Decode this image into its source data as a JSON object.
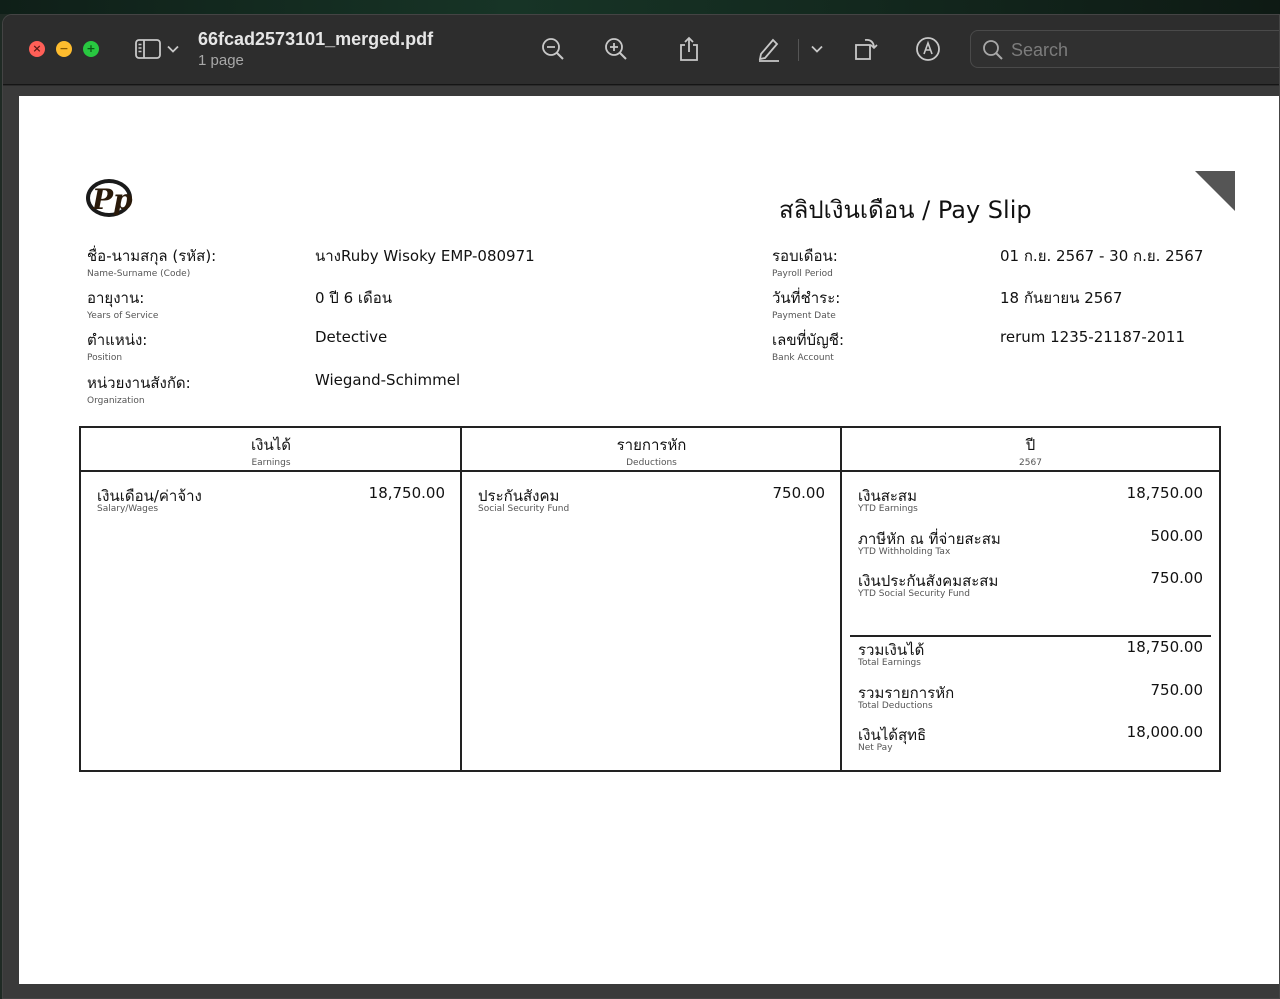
{
  "window": {
    "filename": "66fcad2573101_merged.pdf",
    "page_count": "1 page",
    "search_placeholder": "Search"
  },
  "icons": [
    "close-icon",
    "minimize-icon",
    "fullscreen-icon",
    "sidebar-icon",
    "chevron-down-icon",
    "zoom-out-icon",
    "zoom-in-icon",
    "share-icon",
    "highlight-icon",
    "chevron-down-icon",
    "rotate-icon",
    "markup-icon",
    "search-icon"
  ],
  "slip": {
    "title": "สลิปเงินเดือน / Pay Slip",
    "left_fields": [
      {
        "label": "ชื่อ-นามสกุล (รหัส):",
        "sub": "Name-Surname (Code)",
        "value": "นางRuby Wisoky EMP-080971"
      },
      {
        "label": "อายุงาน:",
        "sub": "Years of Service",
        "value": "0 ปี 6 เดือน"
      },
      {
        "label": "ตำแหน่ง:",
        "sub": "Position",
        "value": "Detective"
      },
      {
        "label": "หน่วยงานสังกัด:",
        "sub": "Organization",
        "value": "Wiegand-Schimmel"
      }
    ],
    "right_fields": [
      {
        "label": "รอบเดือน:",
        "sub": "Payroll Period",
        "value": "01 ก.ย. 2567 - 30 ก.ย. 2567"
      },
      {
        "label": "วันที่ชำระ:",
        "sub": "Payment Date",
        "value": "18 กันยายน 2567"
      },
      {
        "label": "เลขที่บัญชี:",
        "sub": "Bank Account",
        "value": "rerum 1235-21187-2011"
      }
    ],
    "columns": [
      {
        "title": "เงินได้",
        "sub": "Earnings",
        "lines": [
          {
            "label": "เงินเดือน/ค่าจ้าง",
            "sub": "Salary/Wages",
            "value": "18,750.00"
          }
        ]
      },
      {
        "title": "รายการหัก",
        "sub": "Deductions",
        "lines": [
          {
            "label": "ประกันสังคม",
            "sub": "Social Security Fund",
            "value": "750.00"
          }
        ]
      },
      {
        "title": "ปี",
        "sub": "2567",
        "lines": [
          {
            "label": "เงินสะสม",
            "sub": "YTD Earnings",
            "value": "18,750.00"
          },
          {
            "label": "ภาษีหัก ณ ที่จ่ายสะสม",
            "sub": "YTD Withholding Tax",
            "value": "500.00"
          },
          {
            "label": "เงินประกันสังคมสะสม",
            "sub": "YTD Social Security Fund",
            "value": "750.00"
          }
        ],
        "totals": [
          {
            "label": "รวมเงินได้",
            "sub": "Total Earnings",
            "value": "18,750.00"
          },
          {
            "label": "รวมรายการหัก",
            "sub": "Total Deductions",
            "value": "750.00"
          },
          {
            "label": "เงินได้สุทธิ",
            "sub": "Net Pay",
            "value": "18,000.00"
          }
        ]
      }
    ]
  }
}
